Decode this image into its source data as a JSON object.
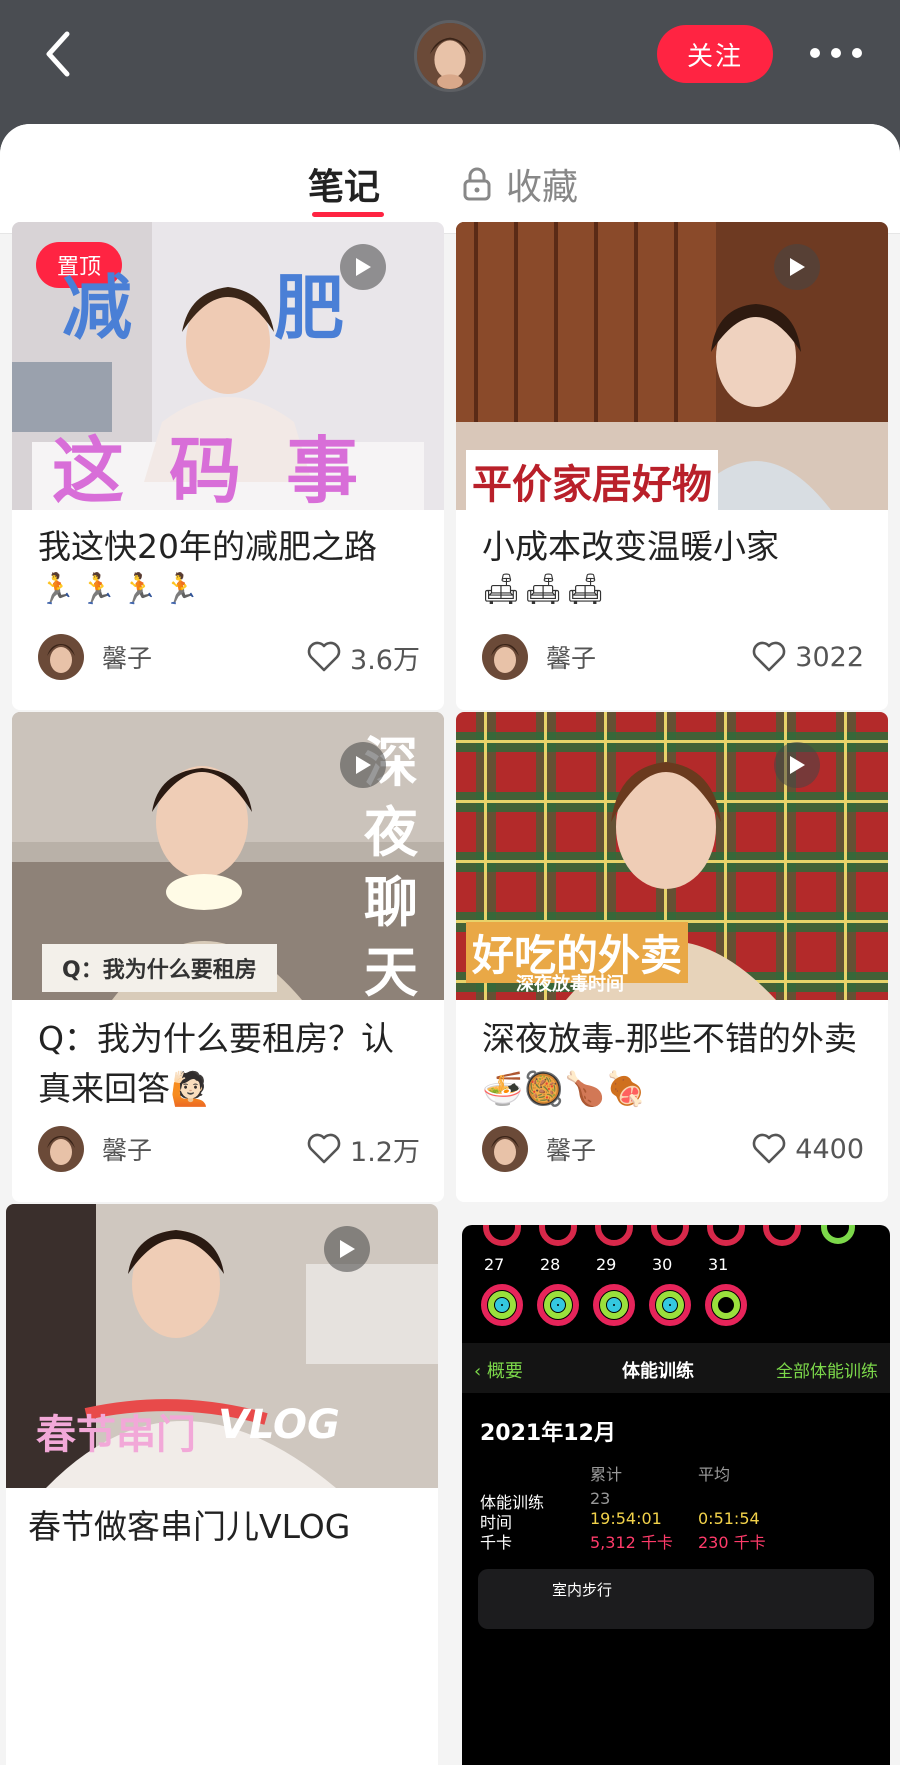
{
  "header": {
    "follow_label": "关注"
  },
  "tabs": {
    "notes": "笔记",
    "favorites": "收藏"
  },
  "cards": [
    {
      "title": "我这快20年的减肥之路",
      "emoji": "🏃🏃🏃🏃",
      "author": "馨子",
      "likes": "3.6万",
      "pinned": "置顶",
      "cover_text": [
        "减",
        "肥",
        "这 码 事"
      ]
    },
    {
      "title": "小成本改变温暖小家",
      "emoji": "🛋🛋🛋",
      "author": "馨子",
      "likes": "3022",
      "cover_text": [
        "平价家居好物"
      ]
    },
    {
      "title": "Q：我为什么要租房？认真来回答🙋🏻",
      "author": "馨子",
      "likes": "1.2万",
      "cover_text": [
        "深",
        "夜",
        "聊",
        "天",
        "Q：我为什么要租房"
      ]
    },
    {
      "title": "深夜放毒-那些不错的外卖🍜🥘🍗🍖",
      "author": "馨子",
      "likes": "4400",
      "cover_text": [
        "好吃的外卖",
        "深夜放毒时间"
      ]
    },
    {
      "title": "春节做客串门儿VLOG",
      "cover_text": [
        "春节串门",
        "VLOG"
      ]
    }
  ],
  "fitness": {
    "days": [
      "27",
      "28",
      "29",
      "30",
      "31"
    ],
    "nav_back": "概要",
    "nav_title": "体能训练",
    "nav_all": "全部体能训练",
    "month": "2021年12月",
    "col_total": "累计",
    "col_avg": "平均",
    "row_workouts": "体能训练",
    "row_time": "时间",
    "row_kcal": "千卡",
    "workouts_total": "23",
    "time_total": "19:54:01",
    "time_avg": "0:51:54",
    "kcal_total": "5,312 千卡",
    "kcal_avg": "230 千卡",
    "bottom_partial": "室内步行"
  }
}
